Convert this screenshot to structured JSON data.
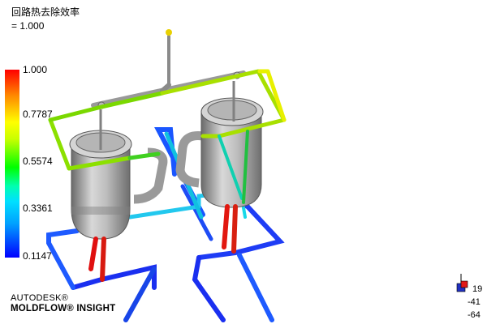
{
  "result": {
    "title": "回路热去除效率",
    "value_line": "= 1.000"
  },
  "legend": {
    "labels": [
      "1.000",
      "0.7787",
      "0.5574",
      "0.3361",
      "0.1147"
    ],
    "colors": {
      "max": "#ff0000",
      "mid_high": "#ffff00",
      "mid": "#00ff00",
      "mid_low": "#00e0ff",
      "min": "#0000ff"
    }
  },
  "branding": {
    "line1": "AUTODESK®",
    "line2": "MOLDFLOW® INSIGHT"
  },
  "triad": {
    "x_label": "19",
    "y_label": "-41",
    "z_label": "-64"
  },
  "icons": {
    "mold_tools": "cylinder-shell-icon",
    "cooling_lines": "pipe-icon",
    "triad": "axis-triad-icon"
  }
}
